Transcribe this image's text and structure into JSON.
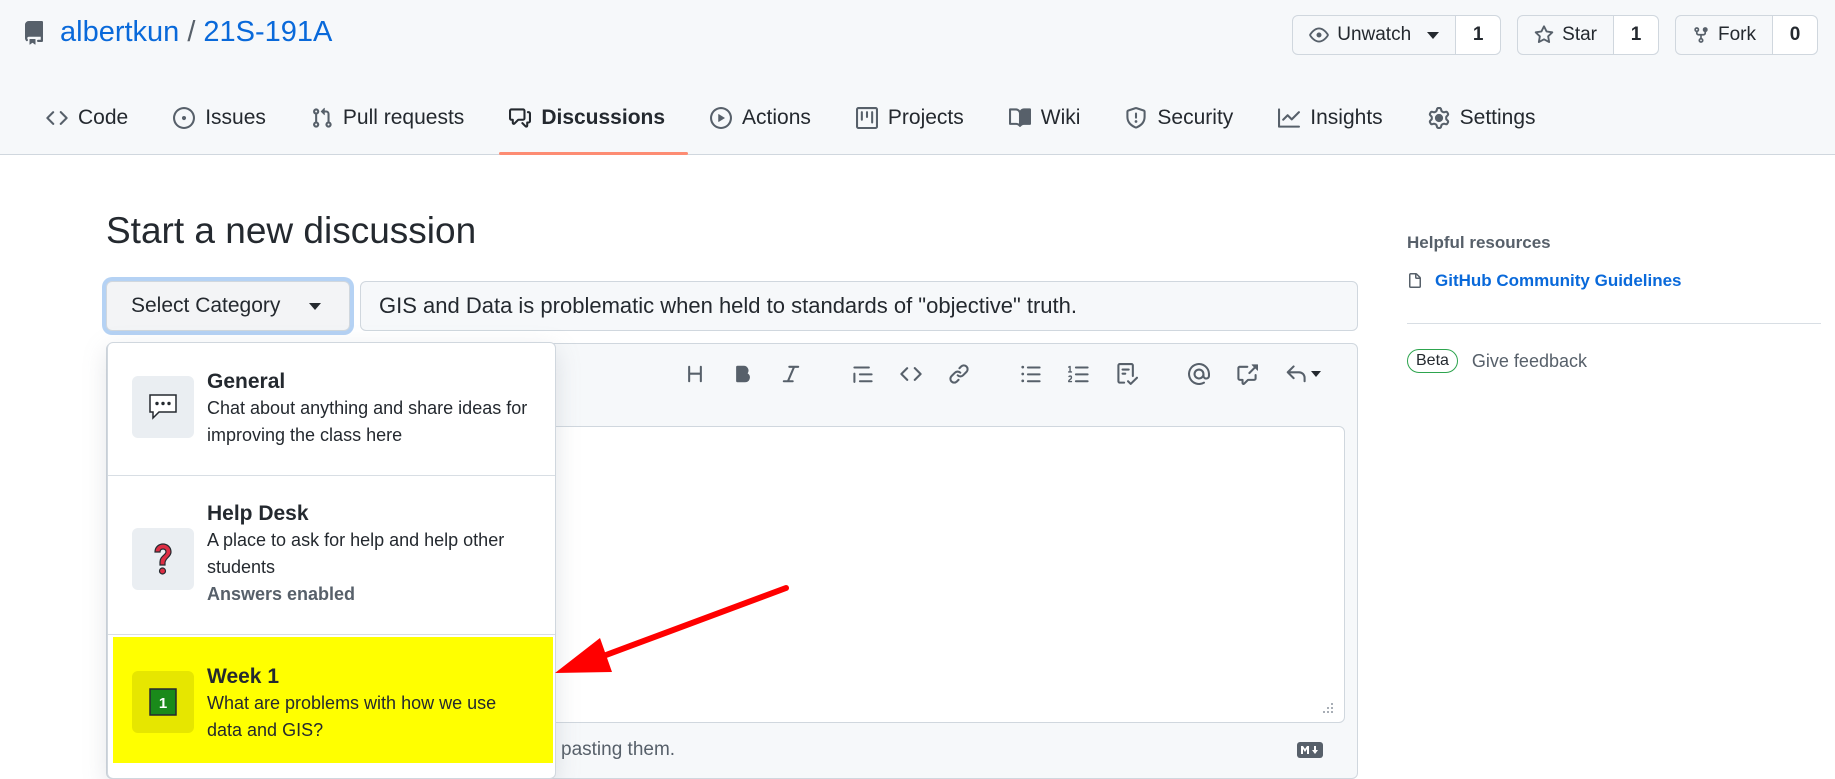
{
  "repo": {
    "owner": "albertkun",
    "separator": "/",
    "name": "21S-191A"
  },
  "actions": {
    "watch": {
      "label": "Unwatch",
      "count": "1"
    },
    "star": {
      "label": "Star",
      "count": "1"
    },
    "fork": {
      "label": "Fork",
      "count": "0"
    }
  },
  "tabs": [
    {
      "label": "Code",
      "icon": "code-icon"
    },
    {
      "label": "Issues",
      "icon": "issue-opened-icon"
    },
    {
      "label": "Pull requests",
      "icon": "git-pull-request-icon"
    },
    {
      "label": "Discussions",
      "icon": "comment-discussion-icon",
      "active": true
    },
    {
      "label": "Actions",
      "icon": "play-icon"
    },
    {
      "label": "Projects",
      "icon": "project-icon"
    },
    {
      "label": "Wiki",
      "icon": "book-icon"
    },
    {
      "label": "Security",
      "icon": "shield-icon"
    },
    {
      "label": "Insights",
      "icon": "graph-icon"
    },
    {
      "label": "Settings",
      "icon": "gear-icon"
    }
  ],
  "main": {
    "title": "Start a new discussion",
    "category_select": "Select Category",
    "title_value": "GIS and Data is problematic when held to standards of \"objective\" truth.",
    "footer_text": "pasting them."
  },
  "categories": [
    {
      "name": "General",
      "description": "Chat about anything and share ideas for improving the class here",
      "icon": "speech-balloon-icon"
    },
    {
      "name": "Help Desk",
      "description": "A place to ask for help and help other students",
      "meta": "Answers enabled",
      "icon": "question-mark-icon"
    },
    {
      "name": "Week 1",
      "description": "What are problems with how we use data and GIS?",
      "icon": "number-one-icon",
      "highlighted": true
    }
  ],
  "sidebar": {
    "heading": "Helpful resources",
    "link": "GitHub Community Guidelines",
    "beta": "Beta",
    "feedback": "Give feedback"
  },
  "colors": {
    "link": "#0969da",
    "active_tab_underline": "#fd8c73",
    "highlight": "#ffff00",
    "annotation_arrow": "#ff0000",
    "beta_border": "#2da44e"
  }
}
